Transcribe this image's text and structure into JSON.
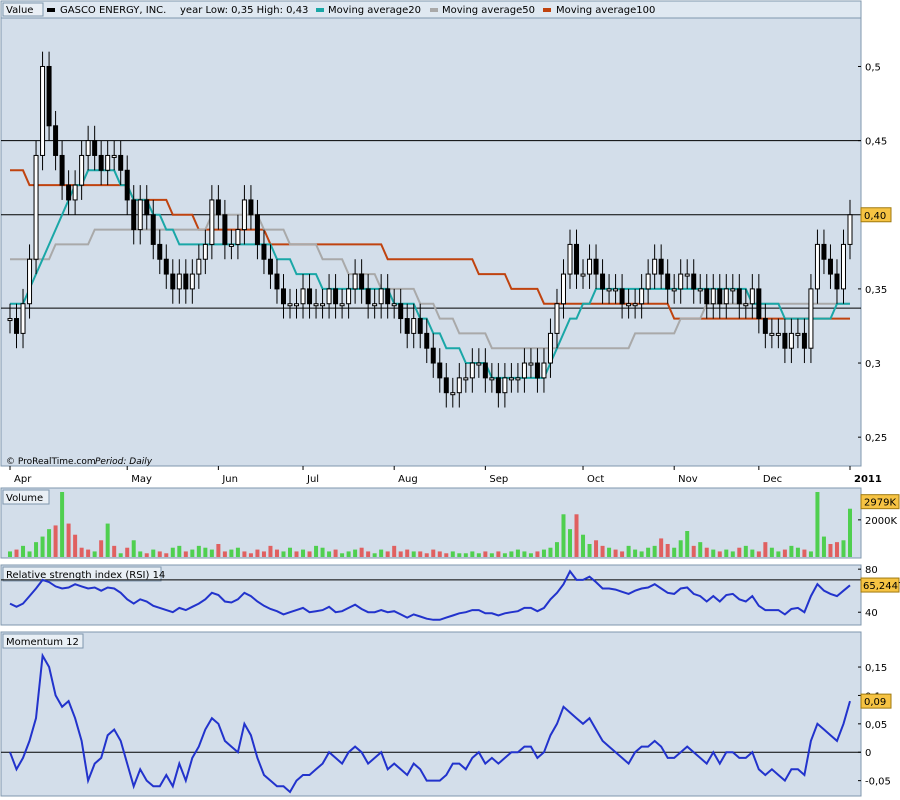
{
  "header": {
    "value_label": "Value",
    "company": "GASCO ENERGY, INC.",
    "year_range": "year Low: 0,35 High: 0,43",
    "ma20_label": "Moving average20",
    "ma50_label": "Moving average50",
    "ma100_label": "Moving average100"
  },
  "colors": {
    "panel_bg": "#d3deea",
    "ma20": "#1aa7a7",
    "ma50": "#a9a9a9",
    "ma100": "#c0430f",
    "volume_up": "#4fcf4f",
    "volume_down": "#e06060",
    "indicator_line": "#2233cc",
    "last_value_bg": "#f6c343"
  },
  "credit": "© ProRealTime.com",
  "period": "Period: Daily",
  "chart_data": [
    {
      "type": "candlestick",
      "panel": "price",
      "x_labels": [
        "Apr",
        "May",
        "Jun",
        "Jul",
        "Aug",
        "Sep",
        "Oct",
        "Nov",
        "Dec",
        "2011"
      ],
      "y_ticks": [
        "0,5",
        "0,45",
        "0,35",
        "0,3",
        "0,25"
      ],
      "ylim": [
        0.24,
        0.53
      ],
      "last_value": "0,40",
      "horizontal_lines": [
        0.45,
        0.4,
        0.337
      ],
      "closes": [
        0.33,
        0.32,
        0.34,
        0.37,
        0.44,
        0.5,
        0.46,
        0.44,
        0.42,
        0.41,
        0.42,
        0.44,
        0.45,
        0.44,
        0.43,
        0.44,
        0.44,
        0.43,
        0.41,
        0.39,
        0.41,
        0.4,
        0.38,
        0.37,
        0.36,
        0.35,
        0.36,
        0.35,
        0.36,
        0.37,
        0.38,
        0.41,
        0.4,
        0.38,
        0.38,
        0.39,
        0.41,
        0.4,
        0.38,
        0.37,
        0.36,
        0.35,
        0.34,
        0.34,
        0.34,
        0.35,
        0.34,
        0.34,
        0.34,
        0.35,
        0.34,
        0.34,
        0.35,
        0.36,
        0.35,
        0.34,
        0.34,
        0.35,
        0.34,
        0.34,
        0.33,
        0.32,
        0.33,
        0.32,
        0.31,
        0.3,
        0.29,
        0.28,
        0.28,
        0.29,
        0.29,
        0.3,
        0.3,
        0.29,
        0.29,
        0.28,
        0.29,
        0.29,
        0.29,
        0.3,
        0.3,
        0.29,
        0.3,
        0.32,
        0.34,
        0.36,
        0.38,
        0.36,
        0.36,
        0.37,
        0.36,
        0.35,
        0.35,
        0.35,
        0.34,
        0.34,
        0.34,
        0.35,
        0.36,
        0.37,
        0.36,
        0.35,
        0.35,
        0.36,
        0.36,
        0.35,
        0.35,
        0.34,
        0.35,
        0.34,
        0.35,
        0.35,
        0.34,
        0.34,
        0.35,
        0.33,
        0.32,
        0.32,
        0.32,
        0.31,
        0.32,
        0.32,
        0.31,
        0.35,
        0.38,
        0.37,
        0.36,
        0.35,
        0.38,
        0.4
      ],
      "ma20": [
        0.34,
        0.34,
        0.34,
        0.35,
        0.36,
        0.37,
        0.38,
        0.39,
        0.4,
        0.41,
        0.42,
        0.42,
        0.43,
        0.43,
        0.43,
        0.43,
        0.43,
        0.42,
        0.42,
        0.41,
        0.41,
        0.41,
        0.4,
        0.4,
        0.39,
        0.39,
        0.38,
        0.38,
        0.38,
        0.38,
        0.38,
        0.38,
        0.38,
        0.38,
        0.38,
        0.38,
        0.38,
        0.38,
        0.38,
        0.38,
        0.38,
        0.37,
        0.37,
        0.37,
        0.36,
        0.36,
        0.36,
        0.36,
        0.35,
        0.35,
        0.35,
        0.35,
        0.35,
        0.35,
        0.35,
        0.35,
        0.35,
        0.35,
        0.35,
        0.34,
        0.34,
        0.34,
        0.34,
        0.33,
        0.33,
        0.32,
        0.32,
        0.31,
        0.31,
        0.31,
        0.3,
        0.3,
        0.3,
        0.3,
        0.29,
        0.29,
        0.29,
        0.29,
        0.29,
        0.29,
        0.29,
        0.29,
        0.29,
        0.3,
        0.31,
        0.32,
        0.33,
        0.33,
        0.34,
        0.34,
        0.35,
        0.35,
        0.35,
        0.35,
        0.35,
        0.35,
        0.35,
        0.35,
        0.35,
        0.35,
        0.35,
        0.35,
        0.35,
        0.35,
        0.35,
        0.35,
        0.35,
        0.35,
        0.35,
        0.35,
        0.35,
        0.35,
        0.35,
        0.35,
        0.34,
        0.34,
        0.34,
        0.34,
        0.34,
        0.33,
        0.33,
        0.33,
        0.33,
        0.33,
        0.33,
        0.33,
        0.33,
        0.34,
        0.34,
        0.34
      ],
      "ma50": [
        0.37,
        0.37,
        0.37,
        0.37,
        0.37,
        0.37,
        0.37,
        0.38,
        0.38,
        0.38,
        0.38,
        0.38,
        0.38,
        0.39,
        0.39,
        0.39,
        0.39,
        0.39,
        0.39,
        0.39,
        0.39,
        0.39,
        0.39,
        0.39,
        0.39,
        0.39,
        0.39,
        0.39,
        0.39,
        0.39,
        0.39,
        0.4,
        0.4,
        0.4,
        0.4,
        0.4,
        0.4,
        0.4,
        0.4,
        0.39,
        0.39,
        0.39,
        0.39,
        0.38,
        0.38,
        0.38,
        0.38,
        0.38,
        0.37,
        0.37,
        0.37,
        0.37,
        0.36,
        0.36,
        0.36,
        0.36,
        0.36,
        0.35,
        0.35,
        0.35,
        0.35,
        0.35,
        0.35,
        0.34,
        0.34,
        0.34,
        0.33,
        0.33,
        0.33,
        0.32,
        0.32,
        0.32,
        0.32,
        0.32,
        0.31,
        0.31,
        0.31,
        0.31,
        0.31,
        0.31,
        0.31,
        0.31,
        0.31,
        0.31,
        0.31,
        0.31,
        0.31,
        0.31,
        0.31,
        0.31,
        0.31,
        0.31,
        0.31,
        0.31,
        0.31,
        0.31,
        0.32,
        0.32,
        0.32,
        0.32,
        0.32,
        0.32,
        0.32,
        0.33,
        0.33,
        0.33,
        0.33,
        0.34,
        0.34,
        0.34,
        0.34,
        0.34,
        0.34,
        0.34,
        0.34,
        0.34,
        0.34,
        0.34,
        0.34,
        0.34,
        0.34,
        0.34,
        0.34,
        0.34,
        0.34,
        0.34,
        0.34,
        0.34,
        0.34,
        0.34
      ],
      "ma100": [
        0.43,
        0.43,
        0.43,
        0.42,
        0.42,
        0.42,
        0.42,
        0.42,
        0.42,
        0.42,
        0.42,
        0.42,
        0.42,
        0.42,
        0.42,
        0.42,
        0.42,
        0.42,
        0.42,
        0.41,
        0.41,
        0.41,
        0.41,
        0.41,
        0.41,
        0.4,
        0.4,
        0.4,
        0.4,
        0.39,
        0.39,
        0.39,
        0.39,
        0.39,
        0.39,
        0.39,
        0.39,
        0.39,
        0.39,
        0.39,
        0.38,
        0.38,
        0.38,
        0.38,
        0.38,
        0.38,
        0.38,
        0.38,
        0.38,
        0.38,
        0.38,
        0.38,
        0.38,
        0.38,
        0.38,
        0.38,
        0.38,
        0.38,
        0.37,
        0.37,
        0.37,
        0.37,
        0.37,
        0.37,
        0.37,
        0.37,
        0.37,
        0.37,
        0.37,
        0.37,
        0.37,
        0.37,
        0.36,
        0.36,
        0.36,
        0.36,
        0.36,
        0.35,
        0.35,
        0.35,
        0.35,
        0.35,
        0.34,
        0.34,
        0.34,
        0.34,
        0.34,
        0.34,
        0.34,
        0.34,
        0.34,
        0.34,
        0.34,
        0.34,
        0.34,
        0.34,
        0.34,
        0.34,
        0.34,
        0.34,
        0.34,
        0.34,
        0.33,
        0.33,
        0.33,
        0.33,
        0.33,
        0.33,
        0.33,
        0.33,
        0.33,
        0.33,
        0.33,
        0.33,
        0.33,
        0.33,
        0.33,
        0.33,
        0.33,
        0.33,
        0.33,
        0.33,
        0.33,
        0.33,
        0.33,
        0.33,
        0.33,
        0.33,
        0.33,
        0.33
      ]
    },
    {
      "type": "bar",
      "panel": "volume",
      "title": "Volume",
      "y_ticks": [
        "2000K"
      ],
      "ylim": [
        0,
        3500
      ],
      "last_value": "2979K",
      "values": [
        300,
        400,
        600,
        300,
        800,
        1100,
        1500,
        1700,
        3500,
        1800,
        1200,
        500,
        400,
        300,
        900,
        1800,
        600,
        200,
        500,
        900,
        300,
        200,
        400,
        300,
        200,
        500,
        600,
        300,
        400,
        600,
        500,
        400,
        700,
        300,
        400,
        500,
        300,
        200,
        400,
        300,
        600,
        400,
        300,
        500,
        300,
        400,
        300,
        600,
        500,
        300,
        400,
        200,
        300,
        400,
        500,
        300,
        200,
        400,
        300,
        600,
        300,
        400,
        300,
        300,
        200,
        400,
        300,
        200,
        300,
        200,
        200,
        300,
        200,
        300,
        200,
        300,
        200,
        300,
        400,
        300,
        200,
        300,
        400,
        500,
        800,
        2300,
        1500,
        2300,
        1200,
        700,
        900,
        600,
        500,
        400,
        300,
        600,
        400,
        300,
        500,
        600,
        1000,
        700,
        500,
        900,
        1400,
        600,
        800,
        500,
        400,
        300,
        400,
        300,
        500,
        600,
        400,
        300,
        800,
        500,
        300,
        400,
        600,
        500,
        400,
        300,
        3500,
        1100,
        700,
        800,
        900,
        2600
      ],
      "up": [
        1,
        0,
        1,
        1,
        1,
        1,
        1,
        0,
        1,
        0,
        0,
        0,
        0,
        1,
        0,
        1,
        0,
        1,
        0,
        1,
        1,
        0,
        1,
        0,
        0,
        1,
        1,
        0,
        1,
        1,
        1,
        1,
        0,
        0,
        1,
        1,
        0,
        0,
        0,
        0,
        0,
        0,
        1,
        1,
        0,
        1,
        0,
        1,
        1,
        1,
        0,
        1,
        1,
        1,
        0,
        0,
        1,
        1,
        0,
        0,
        0,
        0,
        1,
        0,
        0,
        0,
        0,
        0,
        1,
        1,
        1,
        1,
        1,
        0,
        1,
        0,
        1,
        1,
        1,
        1,
        1,
        0,
        1,
        1,
        1,
        1,
        1,
        0,
        1,
        1,
        0,
        0,
        1,
        0,
        0,
        1,
        1,
        1,
        1,
        1,
        0,
        0,
        1,
        1,
        1,
        0,
        1,
        0,
        1,
        0,
        1,
        1,
        0,
        1,
        1,
        0,
        0,
        1,
        1,
        0,
        1,
        1,
        0,
        1,
        1,
        1,
        0,
        0,
        1,
        1
      ]
    },
    {
      "type": "line",
      "panel": "rsi",
      "title": "Relative strength index (RSI) 14",
      "y_ticks": [
        "80",
        "40"
      ],
      "ylim": [
        30,
        82
      ],
      "last_value": "65,2447",
      "reference_line": 70,
      "values": [
        48,
        45,
        48,
        55,
        62,
        70,
        68,
        64,
        62,
        63,
        66,
        64,
        62,
        63,
        60,
        63,
        62,
        58,
        52,
        48,
        52,
        50,
        46,
        44,
        42,
        40,
        44,
        42,
        45,
        48,
        52,
        58,
        56,
        50,
        49,
        52,
        58,
        55,
        50,
        46,
        43,
        41,
        38,
        40,
        42,
        44,
        40,
        41,
        42,
        45,
        40,
        41,
        44,
        47,
        43,
        40,
        40,
        42,
        40,
        41,
        38,
        35,
        38,
        36,
        34,
        33,
        33,
        35,
        37,
        39,
        40,
        42,
        42,
        39,
        39,
        37,
        39,
        40,
        41,
        44,
        44,
        41,
        44,
        52,
        58,
        66,
        78,
        70,
        70,
        73,
        68,
        62,
        62,
        61,
        59,
        57,
        60,
        62,
        63,
        66,
        62,
        58,
        57,
        62,
        63,
        57,
        55,
        50,
        55,
        50,
        56,
        57,
        52,
        50,
        55,
        46,
        42,
        42,
        42,
        38,
        43,
        44,
        40,
        55,
        66,
        60,
        57,
        55,
        60,
        65
      ]
    },
    {
      "type": "line",
      "panel": "momentum",
      "title": "Momentum 12",
      "y_ticks": [
        "0,15",
        "0,1",
        "0,05",
        "0",
        "-0,05"
      ],
      "ylim": [
        -0.07,
        0.18
      ],
      "last_value": "0,09",
      "reference_line": 0,
      "values": [
        0,
        -0.03,
        -0.01,
        0.02,
        0.06,
        0.17,
        0.15,
        0.1,
        0.08,
        0.09,
        0.06,
        0.02,
        -0.05,
        -0.02,
        -0.01,
        0.03,
        0.04,
        0.02,
        -0.02,
        -0.06,
        -0.03,
        -0.05,
        -0.06,
        -0.06,
        -0.04,
        -0.06,
        -0.02,
        -0.05,
        -0.01,
        0.01,
        0.04,
        0.06,
        0.05,
        0.02,
        0.01,
        0.0,
        0.05,
        0.03,
        -0.01,
        -0.04,
        -0.05,
        -0.06,
        -0.06,
        -0.07,
        -0.05,
        -0.04,
        -0.04,
        -0.03,
        -0.02,
        0.0,
        -0.01,
        -0.02,
        0.0,
        0.01,
        0.0,
        -0.02,
        -0.01,
        0.0,
        -0.03,
        -0.02,
        -0.03,
        -0.04,
        -0.02,
        -0.03,
        -0.05,
        -0.05,
        -0.05,
        -0.04,
        -0.02,
        -0.02,
        -0.03,
        -0.01,
        0.0,
        -0.02,
        -0.01,
        -0.02,
        -0.01,
        0.0,
        0.0,
        0.01,
        0.01,
        -0.01,
        0.0,
        0.03,
        0.05,
        0.08,
        0.07,
        0.06,
        0.05,
        0.06,
        0.04,
        0.02,
        0.01,
        0.0,
        -0.01,
        -0.02,
        0.0,
        0.01,
        0.01,
        0.02,
        0.01,
        -0.01,
        -0.01,
        0.0,
        0.01,
        0.0,
        -0.01,
        -0.02,
        0.0,
        -0.02,
        0.0,
        0.0,
        -0.01,
        -0.01,
        0.0,
        -0.03,
        -0.04,
        -0.03,
        -0.04,
        -0.05,
        -0.03,
        -0.03,
        -0.04,
        0.02,
        0.05,
        0.04,
        0.03,
        0.02,
        0.05,
        0.09
      ]
    }
  ]
}
